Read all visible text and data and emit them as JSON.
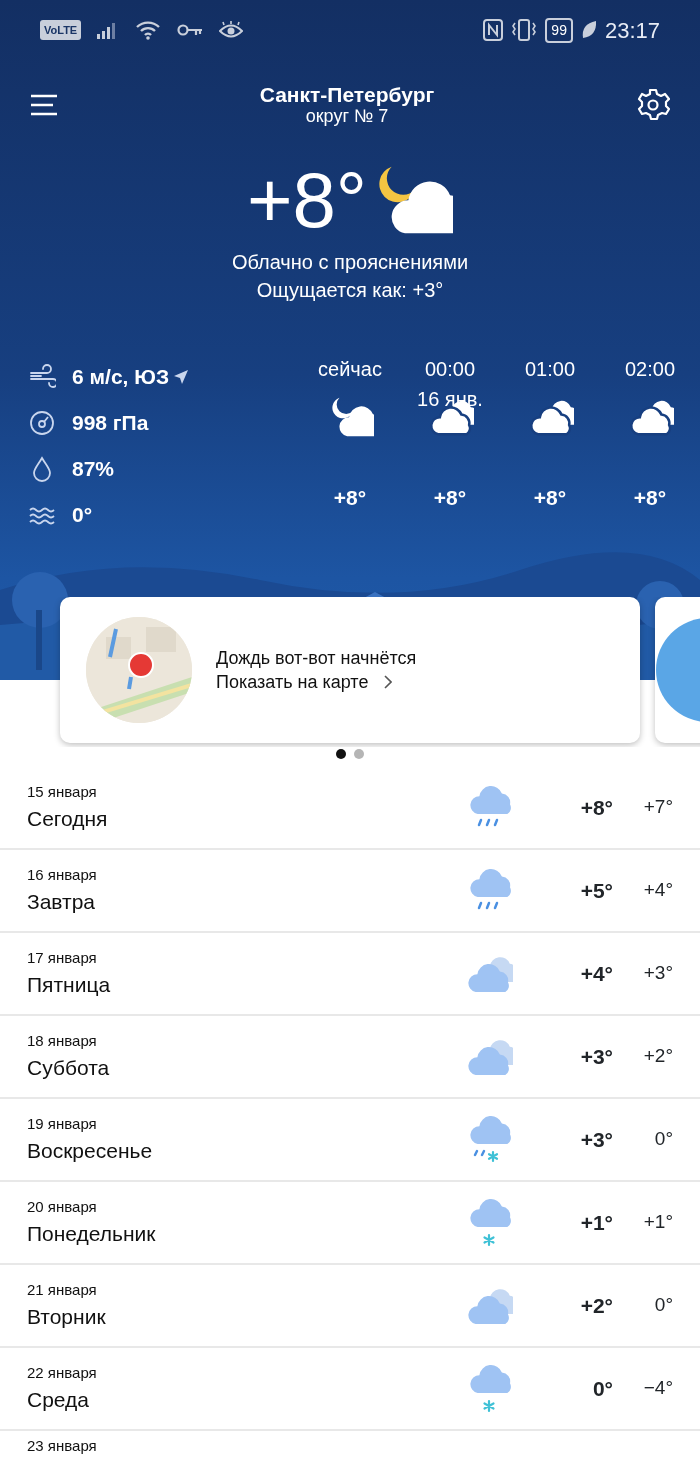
{
  "status_bar": {
    "network": "VoLTE",
    "battery": "99",
    "time": "23:17"
  },
  "header": {
    "city": "Санкт-Петербург",
    "district": "округ № 7"
  },
  "current": {
    "temperature": "+8°",
    "kind": "night-cloudy",
    "condition": "Облачно с прояснениями",
    "feels_like": "Ощущается как: +3°"
  },
  "details": [
    {
      "kind": "wind",
      "value": "6 м/с, ЮЗ"
    },
    {
      "kind": "pressure",
      "value": "998 гПа"
    },
    {
      "kind": "humidity",
      "value": "87%"
    },
    {
      "kind": "water",
      "value": "0°"
    }
  ],
  "hourly": [
    {
      "time": "сейчас",
      "kind": "night-cloudy",
      "temperature": "+8°"
    },
    {
      "time": "00:00",
      "date": "16 янв.",
      "kind": "cloudy",
      "temperature": "+8°"
    },
    {
      "time": "01:00",
      "kind": "cloudy",
      "temperature": "+8°"
    },
    {
      "time": "02:00",
      "kind": "cloudy",
      "temperature": "+8°"
    }
  ],
  "alert_card": {
    "title": "Дождь вот-вот начнётся",
    "link": "Показать на карте"
  },
  "pager": [
    {
      "selected": true
    },
    {
      "selected": false
    }
  ],
  "forecast": [
    {
      "date": "15 января",
      "day": "Сегодня",
      "kind": "rain",
      "high": "+8°",
      "low": "+7°"
    },
    {
      "date": "16 января",
      "day": "Завтра",
      "kind": "rain",
      "high": "+5°",
      "low": "+4°"
    },
    {
      "date": "17 января",
      "day": "Пятница",
      "kind": "cloudy",
      "high": "+4°",
      "low": "+3°"
    },
    {
      "date": "18 января",
      "day": "Суббота",
      "kind": "cloudy",
      "high": "+3°",
      "low": "+2°"
    },
    {
      "date": "19 января",
      "day": "Воскресенье",
      "kind": "rain-snow",
      "high": "+3°",
      "low": "0°"
    },
    {
      "date": "20 января",
      "day": "Понедельник",
      "kind": "snow",
      "high": "+1°",
      "low": "+1°"
    },
    {
      "date": "21 января",
      "day": "Вторник",
      "kind": "cloudy",
      "high": "+2°",
      "low": "0°"
    },
    {
      "date": "22 января",
      "day": "Среда",
      "kind": "snow",
      "high": "0°",
      "low": "−4°"
    },
    {
      "date": "23 января"
    }
  ]
}
